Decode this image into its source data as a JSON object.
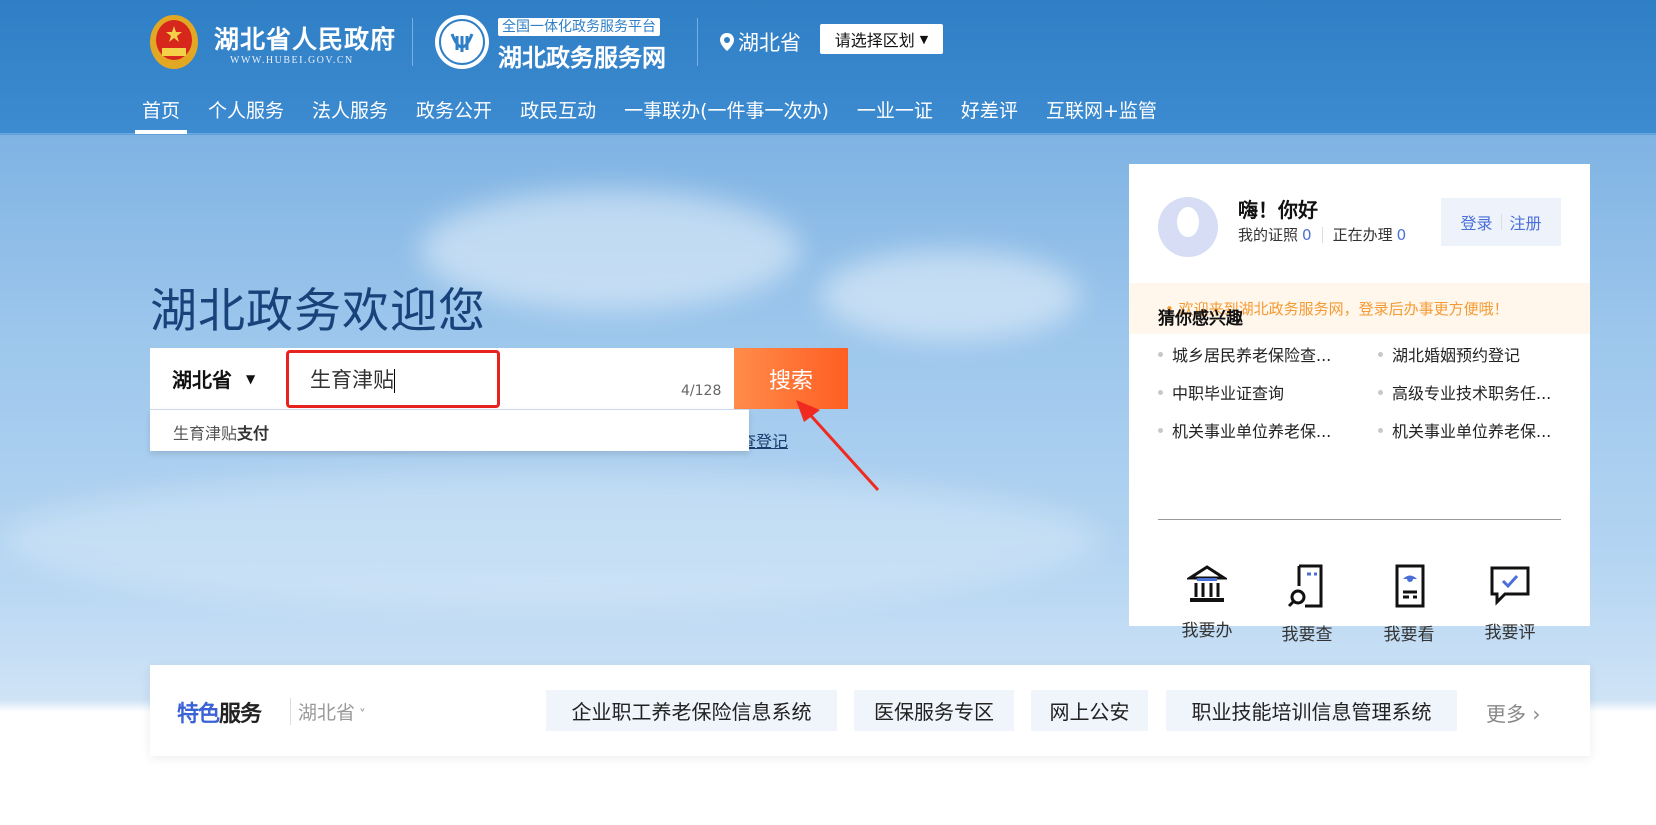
{
  "header": {
    "gov_title": "湖北省人民政府",
    "gov_url": "WWW.HUBEI.GOV.CN",
    "platform_badge": "全国一体化政务服务平台",
    "platform_title": "湖北政务服务网",
    "location": "湖北省",
    "region_select": "请选择区划"
  },
  "nav": [
    "首页",
    "个人服务",
    "法人服务",
    "政务公开",
    "政民互动",
    "一事联办(一件事一次办)",
    "一业一证",
    "好差评",
    "互联网+监管"
  ],
  "hero": {
    "title": "湖北政务欢迎您"
  },
  "search": {
    "scope": "湖北省",
    "query": "生育津贴",
    "counter": "4/128",
    "button": "搜索",
    "suggestion_prefix": "生育津贴",
    "suggestion_bold": "支付",
    "partial_link": "查登记"
  },
  "user_card": {
    "greeting": "嗨！你好",
    "certs_label": "我的证照",
    "certs_count": "0",
    "inprogress_label": "正在办理",
    "inprogress_count": "0",
    "login": "登录",
    "register": "注册",
    "notice": "欢迎来到湖北政务服务网，登录后办事更方便哦！",
    "interest_title": "猜你感兴趣",
    "interest_items": [
      "城乡居民养老保险查...",
      "湖北婚姻预约登记",
      "中职毕业证查询",
      "高级专业技术职务任...",
      "机关事业单位养老保...",
      "机关事业单位养老保..."
    ],
    "quick_actions": [
      {
        "label": "我要办",
        "icon": "bank-icon"
      },
      {
        "label": "我要查",
        "icon": "document-search-icon"
      },
      {
        "label": "我要看",
        "icon": "document-eye-icon"
      },
      {
        "label": "我要评",
        "icon": "chat-check-icon"
      }
    ]
  },
  "featured": {
    "title_a": "特色",
    "title_b": "服务",
    "region": "湖北省",
    "items": [
      "企业职工养老保险信息系统",
      "医保服务专区",
      "网上公安",
      "职业技能培训信息管理系统"
    ],
    "more": "更多"
  },
  "colors": {
    "accent": "#ff6a2b",
    "brand_blue": "#2f7fc6",
    "link_blue": "#4a6fd8",
    "highlight_red": "#e8231f"
  }
}
